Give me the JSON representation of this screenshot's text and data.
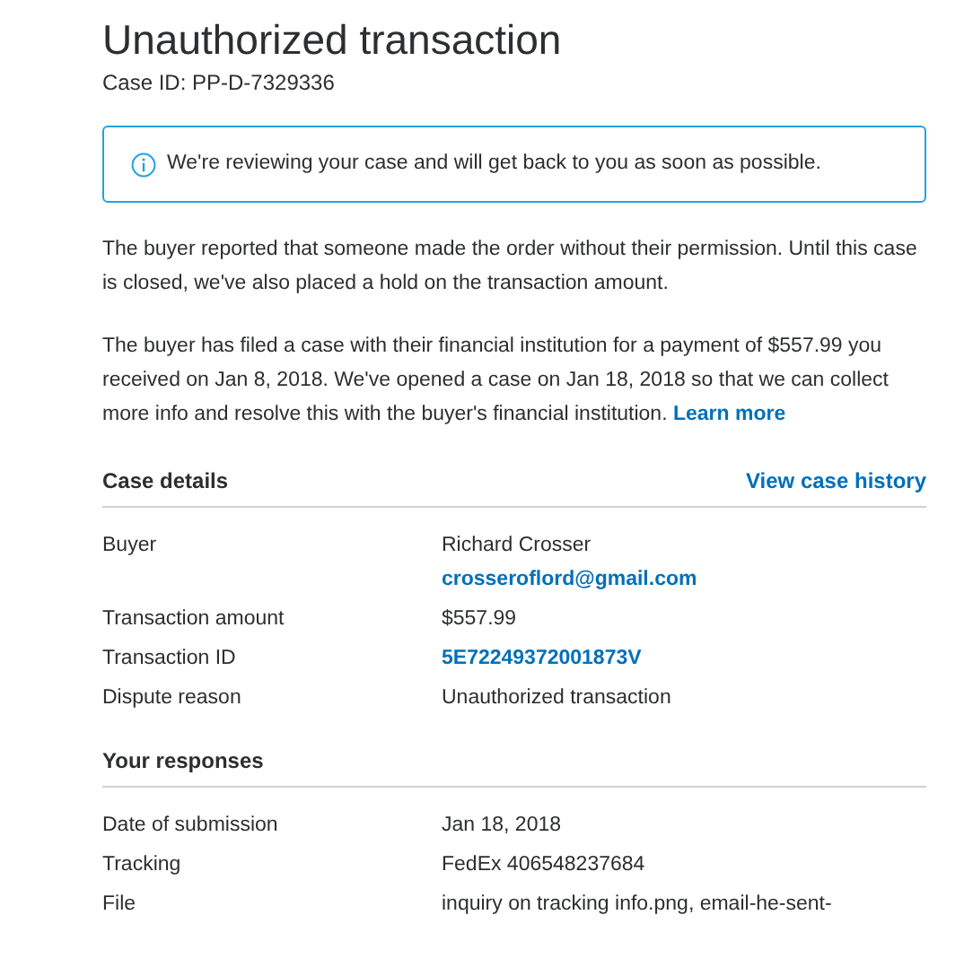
{
  "title": "Unauthorized transaction",
  "case_id": "Case ID: PP-D-7329336",
  "notice": {
    "text": "We're reviewing your case and will get back to you as soon as possible."
  },
  "paragraphs": [
    {
      "text": "The buyer reported that someone made the order without their permission. Until this case is closed, we've also placed a hold on the transaction amount."
    },
    {
      "text": "The buyer has filed a case with their financial institution for a payment of $557.99 you received on Jan 8, 2018. We've opened a case on Jan 18, 2018 so that we can collect more info and resolve this with the buyer's financial institution.",
      "link": "Learn more"
    }
  ],
  "sections": [
    {
      "title": "Case details",
      "link": "View case history",
      "rows": [
        {
          "label": "Buyer",
          "values": [
            {
              "kind": "text",
              "text": "Richard Crosser"
            },
            {
              "kind": "link",
              "text": "crosseroflord@gmail.com"
            }
          ]
        },
        {
          "label": "Transaction amount",
          "values": [
            {
              "kind": "text",
              "text": "$557.99"
            }
          ]
        },
        {
          "label": "Transaction ID",
          "values": [
            {
              "kind": "link",
              "text": "5E72249372001873V"
            }
          ]
        },
        {
          "label": "Dispute reason",
          "values": [
            {
              "kind": "text",
              "text": "Unauthorized transaction"
            }
          ]
        }
      ]
    },
    {
      "title": "Your responses",
      "rows": [
        {
          "label": "Date of submission",
          "values": [
            {
              "kind": "text",
              "text": "Jan 18, 2018"
            }
          ]
        },
        {
          "label": "Tracking",
          "values": [
            {
              "kind": "text",
              "text": "FedEx 406548237684"
            }
          ]
        },
        {
          "label": "File",
          "values": [
            {
              "kind": "text",
              "text": "inquiry on tracking info.png, email-he-sent-"
            }
          ]
        }
      ]
    }
  ]
}
